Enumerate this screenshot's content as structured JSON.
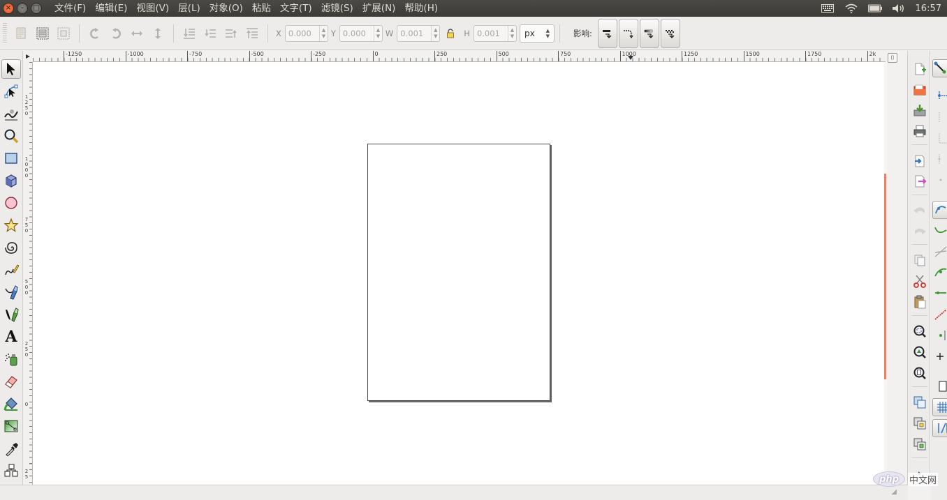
{
  "menubar": {
    "window_buttons": [
      "close",
      "minimize",
      "maximize"
    ],
    "items": [
      "文件(F)",
      "编辑(E)",
      "视图(V)",
      "层(L)",
      "对象(O)",
      "粘贴",
      "文字(T)",
      "滤镜(S)",
      "扩展(N)",
      "帮助(H)"
    ],
    "indicators": [
      "keyboard-icon",
      "wifi-icon",
      "battery-icon",
      "volume-icon"
    ],
    "clock": "16:57"
  },
  "toolbar": {
    "x_label": "X",
    "x_value": "0.000",
    "y_label": "Y",
    "y_value": "0.000",
    "w_label": "W",
    "w_value": "0.001",
    "h_label": "H",
    "h_value": "0.001",
    "unit": "px",
    "affect_label": "影响:"
  },
  "ruler_top": {
    "labels": [
      "-1250",
      "-1000",
      "-750",
      "-500",
      "-250",
      "0",
      "250",
      "500",
      "750",
      "1000",
      "1250",
      "1500",
      "1750",
      "2k"
    ]
  },
  "ruler_left": {
    "labels": [
      "1\n2\n5\n0",
      "1\n0\n0\n0",
      "7\n5\n0",
      "5\n0\n0",
      "2\n5\n0",
      "0",
      "2\n5"
    ]
  },
  "tools": [
    {
      "name": "selector-tool-icon",
      "active": true
    },
    {
      "name": "node-tool-icon"
    },
    {
      "name": "tweak-tool-icon"
    },
    {
      "name": "zoom-tool-icon"
    },
    {
      "name": "rectangle-tool-icon"
    },
    {
      "name": "3d-box-tool-icon"
    },
    {
      "name": "ellipse-tool-icon"
    },
    {
      "name": "star-tool-icon"
    },
    {
      "name": "spiral-tool-icon"
    },
    {
      "name": "pencil-tool-icon"
    },
    {
      "name": "pen-tool-icon"
    },
    {
      "name": "calligraphy-tool-icon"
    },
    {
      "name": "text-tool-icon"
    },
    {
      "name": "spray-tool-icon"
    },
    {
      "name": "eraser-tool-icon"
    },
    {
      "name": "paint-bucket-tool-icon"
    },
    {
      "name": "gradient-tool-icon"
    },
    {
      "name": "dropper-tool-icon"
    },
    {
      "name": "connector-tool-icon"
    }
  ],
  "text_tool_glyph": "A",
  "ruler_end_glyph": "⌷",
  "status_grip": "◢",
  "watermark": {
    "logo": "php",
    "text": "中文网"
  },
  "colors": {
    "scroll_thumb": "#e9825f",
    "menubar": "#3c3b37"
  }
}
